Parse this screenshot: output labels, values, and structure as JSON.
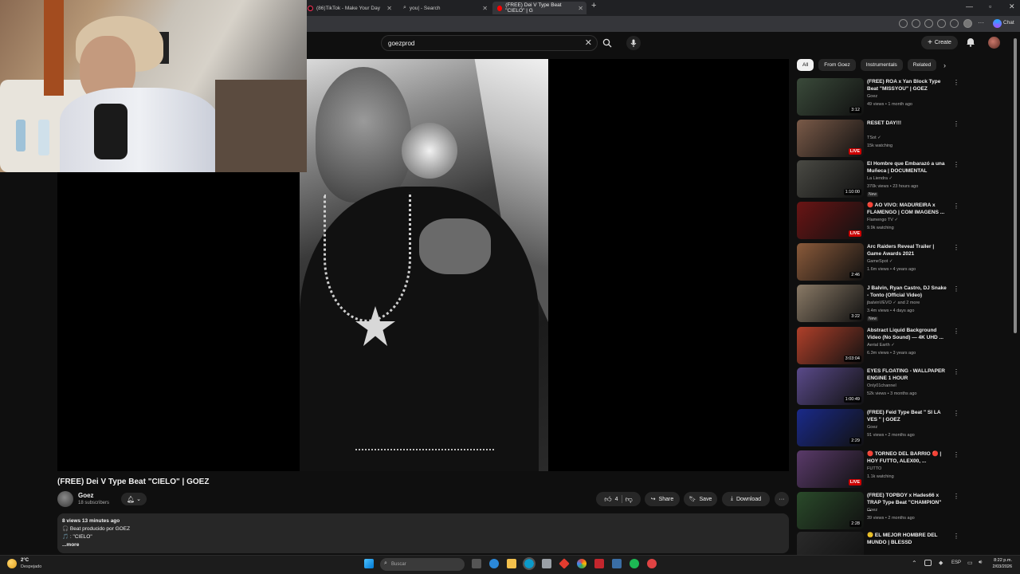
{
  "browser": {
    "tabs": [
      {
        "label": "(86)TikTok - Make Your Day",
        "active": false
      },
      {
        "label": "you| - Search",
        "active": false
      },
      {
        "label": "(FREE) Dei V Type Beat \"CIELO\" | G",
        "active": true
      }
    ],
    "profile_label": "Chat"
  },
  "header": {
    "search_value": "goezprod",
    "create_label": "Create"
  },
  "video": {
    "title": "(FREE) Dei V Type Beat \"CIELO\" | GOEZ",
    "channel": "Goez",
    "subscribers": "18 subscribers",
    "likes": "4",
    "share_label": "Share",
    "save_label": "Save",
    "download_label": "Download",
    "views_line": "8 views  13 minutes ago",
    "desc_line1": "🎧 Beat producido por GOEZ",
    "desc_line2": "🎵 : \"CIELO\"",
    "more_label": "...more"
  },
  "sidebar": {
    "chips": [
      {
        "label": "All",
        "selected": true
      },
      {
        "label": "From Goez",
        "selected": false
      },
      {
        "label": "Instrumentals",
        "selected": false
      },
      {
        "label": "Related",
        "selected": false
      }
    ],
    "recs": [
      {
        "title": "(FREE) ROA x Yan Block Type Beat \"MISSYOU\" | GOEZ",
        "channel": "Goez",
        "meta": "49 views • 1 month ago",
        "badge": "3:12",
        "live": false,
        "new": false,
        "thumb": "#3a4a3a"
      },
      {
        "title": "RESET DAY!!!",
        "channel": "TSot ✓",
        "meta": "15k watching",
        "badge": "LIVE",
        "live": true,
        "new": false,
        "thumb": "#7a5a48"
      },
      {
        "title": "El Hombre que Embarazó a una Muñeca | DOCUMENTAL",
        "channel": "La Liendra ✓",
        "meta": "370k views • 23 hours ago",
        "badge": "1:10:00",
        "live": false,
        "new": true,
        "thumb": "#4a4a44"
      },
      {
        "title": "🔴 AO VIVO: MADUREIRA x FLAMENGO | COM IMAGENS ...",
        "channel": "Flamengo TV ✓",
        "meta": "9.9k watching",
        "badge": "LIVE",
        "live": true,
        "new": false,
        "thumb": "#6a1414"
      },
      {
        "title": "Arc Raiders Reveal Trailer | Game Awards 2021",
        "channel": "GameSpot ✓",
        "meta": "1.6m views • 4 years ago",
        "badge": "2:46",
        "live": false,
        "new": false,
        "thumb": "#8a5a3a"
      },
      {
        "title": "J Balvin, Ryan Castro, DJ Snake - Tonto (Official Video)",
        "channel": "jbalvinVEVO ✓ and 2 more",
        "meta": "3.4m views • 4 days ago",
        "badge": "3:22",
        "live": false,
        "new": true,
        "thumb": "#8a7a66"
      },
      {
        "title": "Abstract Liquid Background Video (No Sound) — 4K UHD ...",
        "channel": "Aerial Earth ✓",
        "meta": "6.3m views • 3 years ago",
        "badge": "3:03:04",
        "live": false,
        "new": false,
        "thumb": "#b0402a"
      },
      {
        "title": "EYES FLOATING - WALLPAPER ENGINE 1 HOUR",
        "channel": "Only01channel",
        "meta": "52k views • 3 months ago",
        "badge": "1:00:49",
        "live": false,
        "new": false,
        "thumb": "#5a4a8a"
      },
      {
        "title": "(FREE) Feid  Type Beat \" SI LA VES \" | GOEZ",
        "channel": "Goez",
        "meta": "91 views • 2 months ago",
        "badge": "2:29",
        "live": false,
        "new": false,
        "thumb": "#1a2a8a"
      },
      {
        "title": "🔴 TORNEO DEL BARRIO 🔴 | HOY FUTTO, ALEX00, ...",
        "channel": "FUTTO",
        "meta": "1.1k watching",
        "badge": "LIVE",
        "live": true,
        "new": false,
        "thumb": "#5a3a6a"
      },
      {
        "title": "(FREE) TOPBOY x Hades66 x TRAP Type Beat \"CHAMPION\" ...",
        "channel": "Goez",
        "meta": "39 views • 2 months ago",
        "badge": "2:28",
        "live": false,
        "new": false,
        "thumb": "#2a4a2a"
      },
      {
        "title": "🙂 EL MEJOR HOMBRE DEL MUNDO | BLESSD",
        "channel": "",
        "meta": "",
        "badge": "",
        "live": false,
        "new": false,
        "thumb": "#2a2a2a"
      }
    ]
  },
  "taskbar": {
    "weather_temp": "2°C",
    "weather_desc": "Despejado",
    "search_placeholder": "Buscar",
    "lang": "ESP",
    "time": "8:22 p.m.",
    "date": "2/03/2026"
  },
  "colors": {
    "accent_live": "#cc0000",
    "bg": "#0f0f0f",
    "pill": "#272727"
  }
}
